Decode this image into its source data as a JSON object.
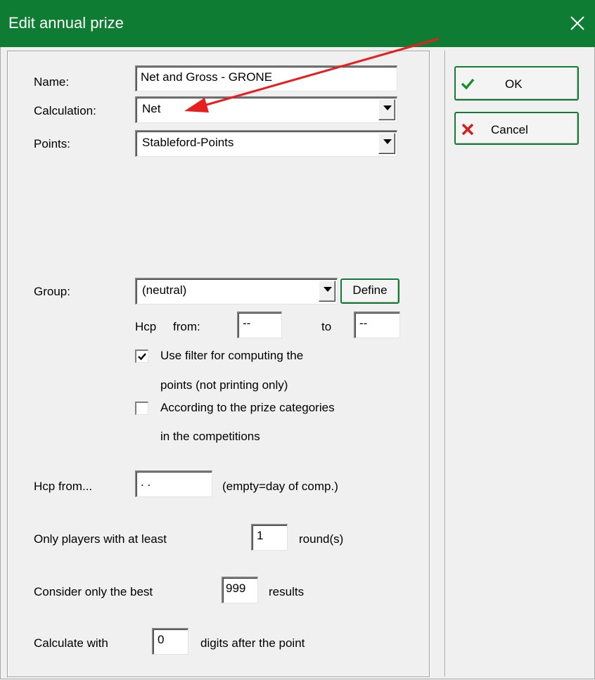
{
  "window": {
    "title": "Edit annual prize"
  },
  "form": {
    "name_label": "Name:",
    "name_value": "Net and Gross - GRONE",
    "calculation_label": "Calculation:",
    "calculation_value": "Net",
    "points_label": "Points:",
    "points_value": "Stableford-Points",
    "group_label": "Group:",
    "group_value": "(neutral)",
    "define_label": "Define",
    "hcp_label": "Hcp",
    "from_label": "from:",
    "hcp_from_value": "--",
    "to_label": "to",
    "hcp_to_value": "--",
    "filter_line1": "Use filter for computing the",
    "filter_line2": "points (not printing only)",
    "filter_checked": true,
    "categories_line1": "According to the prize categories",
    "categories_line2": "in the competitions",
    "categories_checked": false,
    "hcp_from_label": "Hcp from...",
    "hcp_date_value": " .  .",
    "hcp_date_hint": "(empty=day of comp.)",
    "only_players_label": "Only players with at least",
    "rounds_value": "1",
    "rounds_label": "round(s)",
    "best_label": "Consider only the best",
    "best_value": "999",
    "results_label": "results",
    "calc_with_label": "Calculate with",
    "digits_value": "0",
    "digits_label": "digits after the point"
  },
  "buttons": {
    "ok_label": "OK",
    "cancel_label": "Cancel"
  },
  "colors": {
    "titlebar": "#0e7d33",
    "annotation_arrow": "#e81e1e"
  }
}
